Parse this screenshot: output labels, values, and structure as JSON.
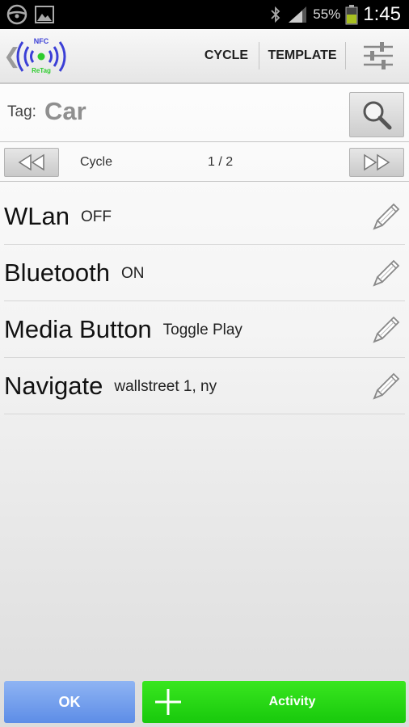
{
  "status_bar": {
    "battery_percent": "55%",
    "time": "1:45",
    "icons": [
      "steering-wheel-icon",
      "image-icon",
      "bluetooth-icon",
      "signal-icon",
      "battery-icon"
    ]
  },
  "action_bar": {
    "logo_nfc": "NFC",
    "logo_retag": "ReTag",
    "cycle_label": "CYCLE",
    "template_label": "TEMPLATE",
    "settings_icon": "sliders-icon"
  },
  "tag": {
    "label": "Tag:",
    "value": "Car"
  },
  "cycle_nav": {
    "label": "Cycle",
    "position": "1 / 2"
  },
  "activities": [
    {
      "name": "WLan",
      "value": "OFF"
    },
    {
      "name": "Bluetooth",
      "value": "ON"
    },
    {
      "name": "Media Button",
      "value": "Toggle Play"
    },
    {
      "name": "Navigate",
      "value": "wallstreet 1, ny"
    }
  ],
  "footer": {
    "ok_label": "OK",
    "activity_label": "Activity"
  },
  "colors": {
    "ok_button": "#6f9ced",
    "activity_button": "#22d814",
    "logo_waves": "#3b3fd6",
    "logo_dot": "#2ecc2e"
  }
}
